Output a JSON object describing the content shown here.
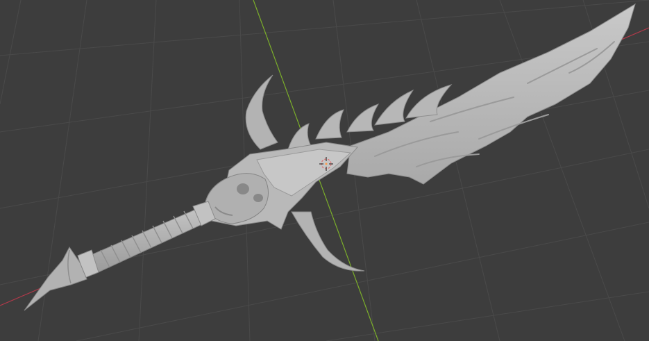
{
  "viewport": {
    "background": "#3d3d3d",
    "grid_color": "#4a4a4a",
    "x_axis_color": "#b3394a",
    "y_axis_color": "#7bae2a"
  },
  "scene": {
    "object": "sword-model",
    "mesh_color": "#b4b4b4",
    "mesh_highlight": "#cfcfcf",
    "mesh_shadow": "#8a8a8a",
    "origin_marker_color": "#e07070"
  }
}
